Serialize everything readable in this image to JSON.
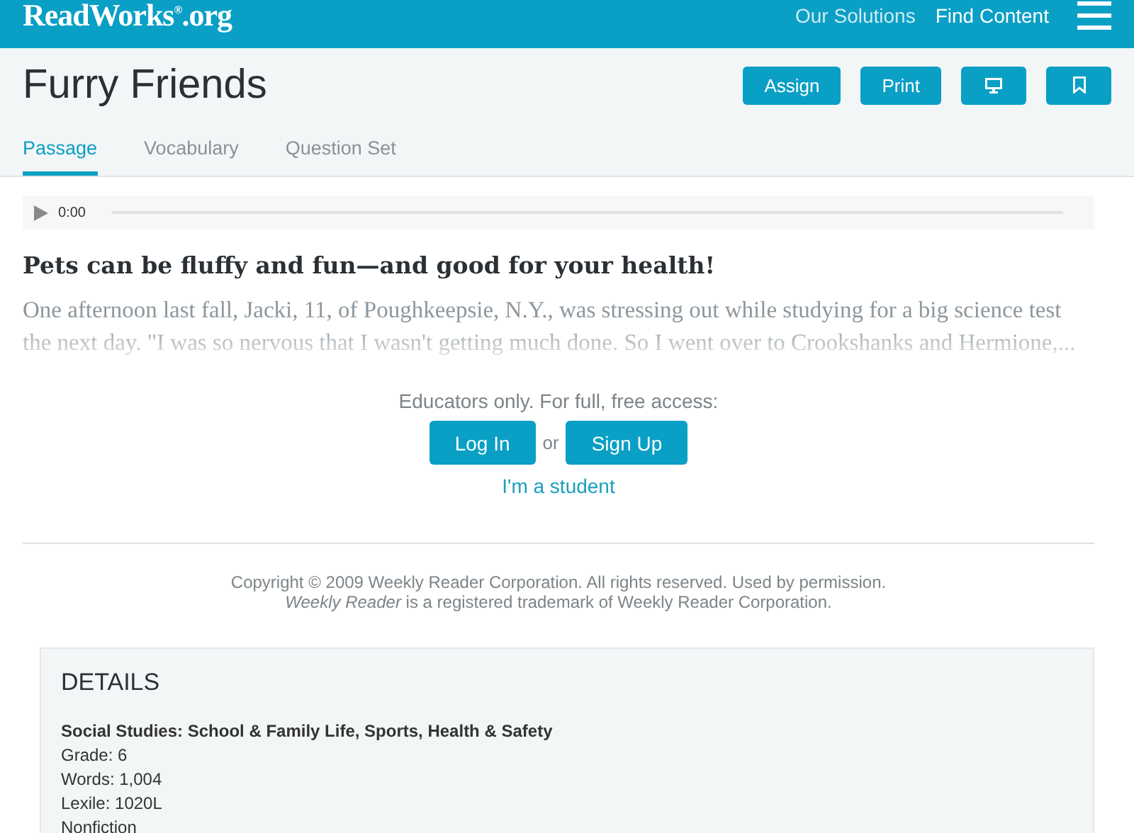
{
  "header": {
    "logo": "ReadWorks$^{®}$.org",
    "nav": [
      "Our Solutions",
      "Find Content"
    ]
  },
  "title": "Furry Friends",
  "actions": [
    {
      "kind": "text",
      "label": "Assign"
    },
    {
      "kind": "text",
      "label": "Print"
    },
    {
      "kind": "monitor"
    },
    {
      "kind": "bookmark"
    }
  ],
  "tabs": [
    {
      "label": "Passage",
      "selected": true
    },
    {
      "label": "Vocabulary",
      "selected": false
    },
    {
      "label": "Question Set",
      "selected": false
    }
  ],
  "audio": {
    "time": "0:00"
  },
  "heading": "Pets can be fluffy and fun—and good for your health!",
  "excerpt": "One afternoon last fall, Jacki, 11, of Poughkeepsie, N.Y., was stressing out while studying for a big science test the next day. \"I was so nervous that I wasn't getting much done. So I went over to Crookshanks and Hermione,...",
  "access": {
    "prompt": "Educators only. For full, free access:",
    "login": "Log In",
    "or": "or",
    "signup": "Sign Up",
    "student": "I'm a student"
  },
  "copyright": [
    "Copyright © 2009 Weekly Reader Corporation. All rights reserved. Used by permission.",
    "*Weekly Reader* is a registered trademark of Weekly Reader Corporation."
  ],
  "details": {
    "title": "DETAILS",
    "subject": "Social Studies: School & Family Life, Sports, Health & Safety",
    "lines": [
      "Grade: 6",
      "Words: 1,004",
      "Lexile: 1020L",
      "Nonfiction"
    ]
  }
}
